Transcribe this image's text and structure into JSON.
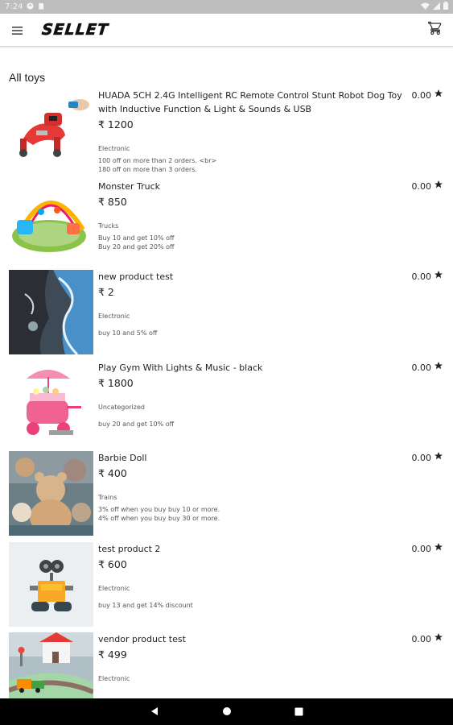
{
  "status_bar": {
    "time": "7:24"
  },
  "app_bar": {
    "logo": "SELLET"
  },
  "section_title": "All toys",
  "products": [
    {
      "name": "HUADA 5CH 2.4G Intelligent RC Remote Control Stunt Robot Dog Toy with Inductive Function & Light & Sounds & USB",
      "price": "₹ 1200",
      "category": "Electronic",
      "offer_1": "100 off on more than 2 orders. <br>",
      "offer_2": "180 off on more than 3 orders.",
      "rating": "0.00",
      "image": "robot-dog"
    },
    {
      "name": "Monster Truck",
      "price": "₹ 850",
      "category": "Trucks",
      "offer_1": "Buy 10 and get 10% off",
      "offer_2": "Buy 20 and get 20% off",
      "rating": "0.00",
      "image": "baby-play-gym"
    },
    {
      "name": "new product test",
      "price": "₹ 2",
      "category": "Electronic",
      "offer_1": "buy 10 and 5% off",
      "offer_2": "",
      "rating": "0.00",
      "image": "abstract-painting"
    },
    {
      "name": "Play Gym With Lights & Music - black",
      "price": "₹ 1800",
      "category": "Uncategorized",
      "offer_1": "buy 20 and get 10% off",
      "offer_2": "",
      "rating": "0.00",
      "image": "ice-cream-cart"
    },
    {
      "name": "Barbie Doll",
      "price": "₹ 400",
      "category": "Trains",
      "offer_1": "3% off when you buy buy 10 or more.",
      "offer_2": "4% off when you buy buy 30 or more.",
      "rating": "0.00",
      "image": "teddy-bears"
    },
    {
      "name": "test product 2",
      "price": "₹ 600",
      "category": "Electronic",
      "offer_1": "buy 13 and get 14% discount",
      "offer_2": "",
      "rating": "0.00",
      "image": "wall-e-robot"
    },
    {
      "name": "vendor product test",
      "price": "₹ 499",
      "category": "Electronic",
      "offer_1": "",
      "offer_2": "",
      "rating": "0.00",
      "image": "wooden-train-set"
    }
  ],
  "colors": {
    "status_bar": "#bdbdbd",
    "nav_bar": "#000000",
    "text": "#212121"
  }
}
